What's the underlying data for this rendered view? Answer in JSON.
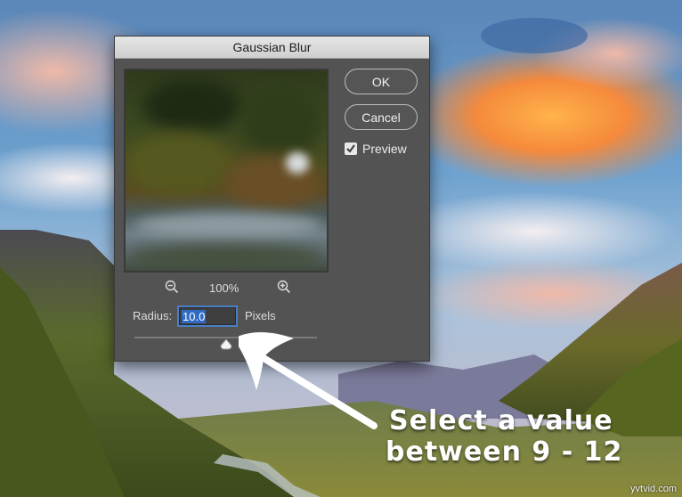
{
  "dialog": {
    "title": "Gaussian Blur",
    "ok_label": "OK",
    "cancel_label": "Cancel",
    "preview_checkbox": {
      "label": "Preview",
      "checked": true
    },
    "zoom": {
      "level": "100%",
      "zoom_out_icon": "zoom-out-icon",
      "zoom_in_icon": "zoom-in-icon"
    },
    "radius": {
      "label": "Radius:",
      "value": "10.0",
      "unit": "Pixels"
    },
    "slider": {
      "value": 10.0,
      "min": 0.1,
      "max": 1000
    }
  },
  "annotation": {
    "line1": "Select a value",
    "line2": "between 9 - 12",
    "arrow_icon": "arrow-pointer-icon"
  },
  "watermark": "yvtvid.com",
  "colors": {
    "dialog_bg": "#535353",
    "highlight": "#2f6bc4",
    "annotation_text": "#ffffff"
  }
}
